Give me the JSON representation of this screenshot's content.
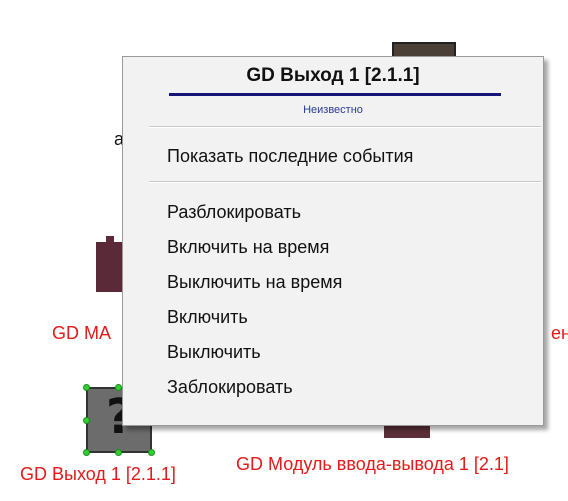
{
  "background": {
    "stray_char": "a",
    "label_mid_left": "GD MA",
    "label_mid_right": "ен",
    "label_bottom_left": "GD Выход 1 [2.1.1]",
    "label_bottom_right": "GD Модуль ввода-вывода 1 [2.1]",
    "question_glyph": "?",
    "label_color": "#e21a1a"
  },
  "context_menu": {
    "title": "GD Выход 1 [2.1.1]",
    "status": "Неизвестно",
    "title_bar_color": "#15147a",
    "items_group1": [
      {
        "label": "Показать последние события"
      }
    ],
    "items_group2": [
      {
        "label": "Разблокировать"
      },
      {
        "label": "Включить на время"
      },
      {
        "label": "Выключить на время"
      },
      {
        "label": "Включить"
      },
      {
        "label": "Выключить"
      },
      {
        "label": "Заблокировать"
      }
    ]
  }
}
